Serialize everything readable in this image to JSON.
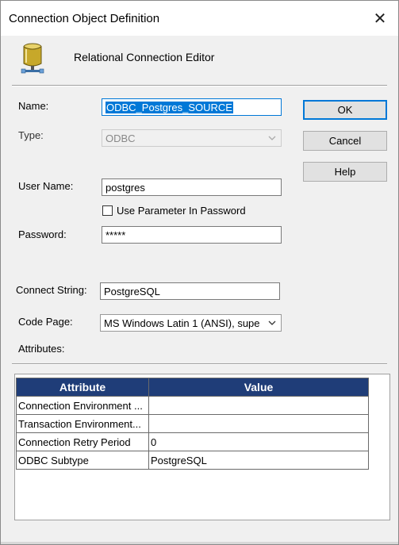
{
  "window": {
    "title": "Connection Object Definition"
  },
  "header": {
    "label": "Relational Connection Editor",
    "icon": "database-icon"
  },
  "form": {
    "name_label": "Name:",
    "name_value": "ODBC_Postgres_SOURCE",
    "type_label": "Type:",
    "type_value": "ODBC",
    "username_label": "User Name:",
    "username_value": "postgres",
    "use_param_label": "Use Parameter In Password",
    "use_param_checked": false,
    "password_label": "Password:",
    "password_value": "*****",
    "connect_string_label": "Connect String:",
    "connect_string_value": "PostgreSQL",
    "code_page_label": "Code Page:",
    "code_page_value": "MS Windows Latin 1 (ANSI), supe",
    "attributes_label": "Attributes:"
  },
  "buttons": {
    "ok": "OK",
    "cancel": "Cancel",
    "help": "Help"
  },
  "attributes_table": {
    "headers": [
      "Attribute",
      "Value"
    ],
    "rows": [
      [
        "Connection Environment ...",
        ""
      ],
      [
        "Transaction Environment...",
        ""
      ],
      [
        "Connection Retry Period",
        "0"
      ],
      [
        "ODBC Subtype",
        "PostgreSQL"
      ]
    ]
  },
  "colors": {
    "table_header_bg": "#1f3d78",
    "selection": "#0078d7",
    "dialog_bg": "#f0f0f0"
  }
}
